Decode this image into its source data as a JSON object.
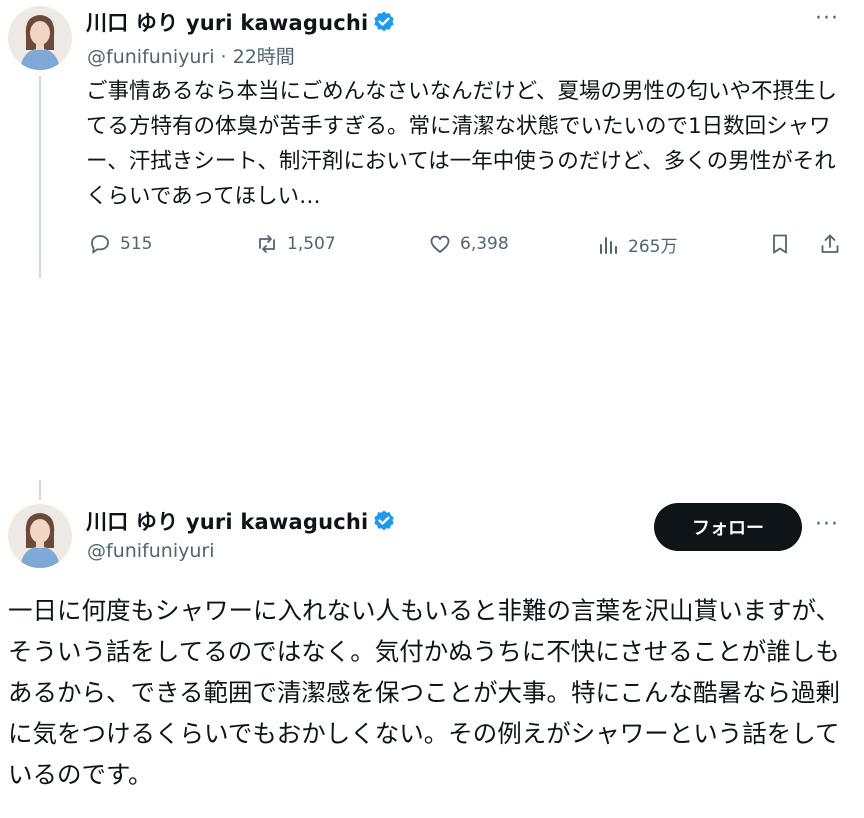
{
  "tweet1": {
    "display_name": "川口 ゆり yuri kawaguchi",
    "handle": "@funifuniyuri",
    "time": "· 22時間",
    "body": "ご事情あるなら本当にごめんなさいなんだけど、夏場の男性の匂いや不摂生してる方特有の体臭が苦手すぎる。常に清潔な状態でいたいので1日数回シャワー、汗拭きシート、制汗剤においては一年中使うのだけど、多くの男性がそれくらいであってほしい…",
    "more": "···",
    "actions": {
      "reply_count": "515",
      "retweet_count": "1,507",
      "like_count": "6,398",
      "views_count": "265万"
    }
  },
  "tweet2": {
    "display_name": "川口 ゆり yuri kawaguchi",
    "handle": "@funifuniyuri",
    "follow_label": "フォロー",
    "more": "···",
    "body": "一日に何度もシャワーに入れない人もいると非難の言葉を沢山貰いますが、そういう話をしてるのではなく。気付かぬうちに不快にさせることが誰しもあるから、できる範囲で清潔感を保つことが大事。特にこんな酷暑なら過剰に気をつけるくらいでもおかしくない。その例えがシャワーという話をしているのです。"
  },
  "colors": {
    "verified": "#1d9bf0",
    "text": "#0f1419",
    "secondary": "#536471",
    "follow_bg": "#0f1419"
  },
  "icons": [
    "verified-badge-icon",
    "more-icon",
    "reply-icon",
    "retweet-icon",
    "like-icon",
    "views-icon",
    "bookmark-icon",
    "share-icon"
  ]
}
